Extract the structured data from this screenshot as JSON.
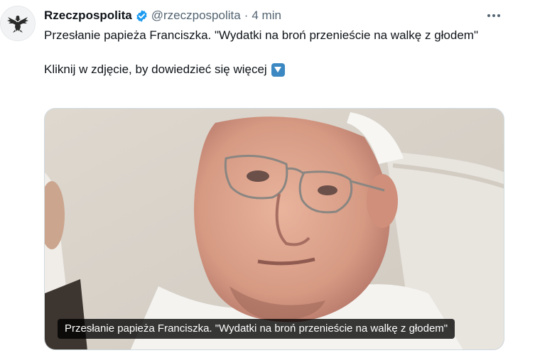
{
  "author": {
    "name": "Rzeczpospolita",
    "handle": "@rzeczpospolita",
    "separator": "·",
    "time": "4 min",
    "avatar_icon": "eagle-logo-icon",
    "verified_icon": "verified-badge-icon"
  },
  "tweet": {
    "title": "Przesłanie papieża Franciszka. \"Wydatki na broń przenieście na walkę z głodem\"",
    "cta": "Kliknij w zdjęcie, by dowiedzieć się więcej",
    "cta_emoji": "down-arrow-button-icon"
  },
  "media": {
    "caption": "Przesłanie papieża Franciszka. \"Wydatki na broń przenieście na walkę z głodem\""
  },
  "colors": {
    "text_primary": "#0f1419",
    "text_secondary": "#536471",
    "verified_blue": "#1d9bf0",
    "border": "#cfd9de"
  }
}
